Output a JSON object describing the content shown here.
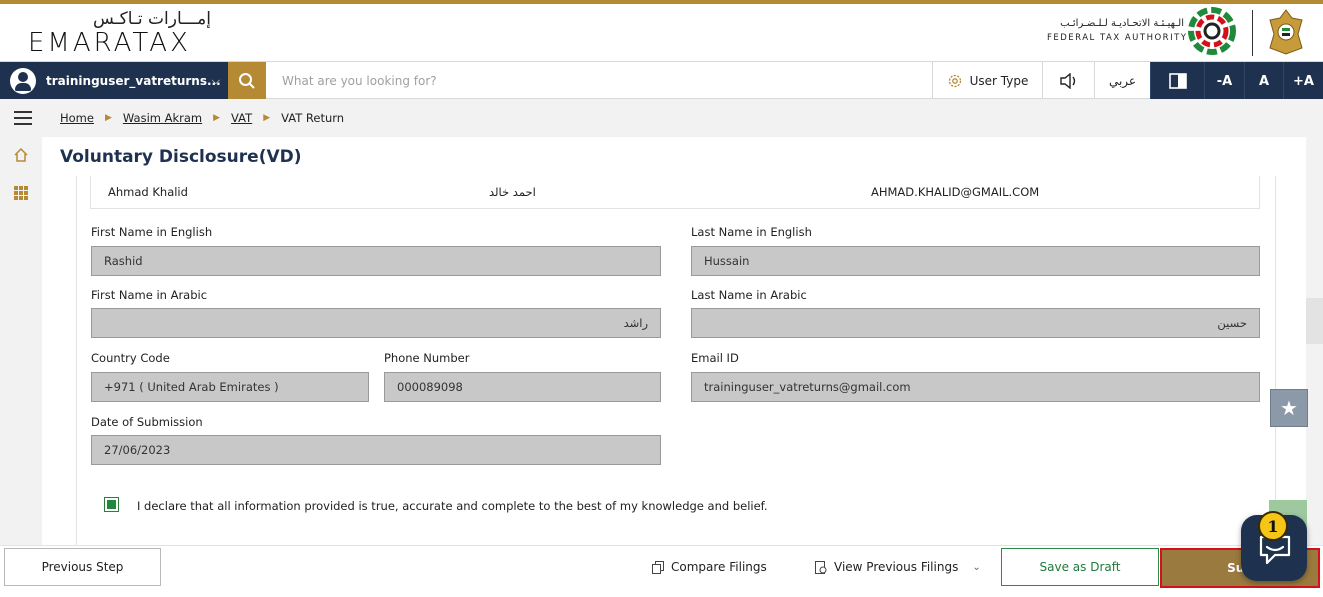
{
  "header": {
    "logo_ar": "إمـــارات تـاكـس",
    "logo_en": "EMARATAX",
    "authority_ar": "الـهيـئـة الاتحـاديـة لـلـضـرائـب",
    "authority_en": "FEDERAL TAX AUTHORITY"
  },
  "navbar": {
    "username": "traininguser_vatreturns...",
    "search_placeholder": "What are you looking for?",
    "user_type_label": "User Type",
    "language_label": "عربي",
    "font_decrease": "-A",
    "font_normal": "A",
    "font_increase": "+A"
  },
  "breadcrumb": [
    "Home",
    "Wasim Akram",
    "VAT",
    "VAT Return"
  ],
  "page_title": "Voluntary Disclosure(VD)",
  "summary_row": {
    "name_en": "Ahmad Khalid",
    "name_ar": "احمد خالد",
    "email": "AHMAD.KHALID@GMAIL.COM"
  },
  "form": {
    "first_name_en": {
      "label": "First Name in English",
      "value": "Rashid"
    },
    "last_name_en": {
      "label": "Last Name in English",
      "value": "Hussain"
    },
    "first_name_ar": {
      "label": "First Name in Arabic",
      "value": "راشد"
    },
    "last_name_ar": {
      "label": "Last Name in Arabic",
      "value": "حسين"
    },
    "country_code": {
      "label": "Country Code",
      "value": "+971 ( United Arab Emirates )"
    },
    "phone": {
      "label": "Phone Number",
      "value": "000089098"
    },
    "email": {
      "label": "Email ID",
      "value": "traininguser_vatreturns@gmail.com"
    },
    "submission_date": {
      "label": "Date of Submission",
      "value": "27/06/2023"
    }
  },
  "declaration": {
    "checked": true,
    "text": "I declare that all information provided is true, accurate and complete to the best of my knowledge and belief."
  },
  "footer": {
    "previous_step": "Previous Step",
    "compare_filings": "Compare Filings",
    "view_previous_filings": "View Previous Filings",
    "save_draft": "Save as Draft",
    "submit": "Sub"
  },
  "chat_badge": "1",
  "colors": {
    "brand_gold": "#b68a35",
    "navy": "#1e3250",
    "submit_highlight": "#d4101b",
    "draft_green": "#1f7a3c"
  }
}
